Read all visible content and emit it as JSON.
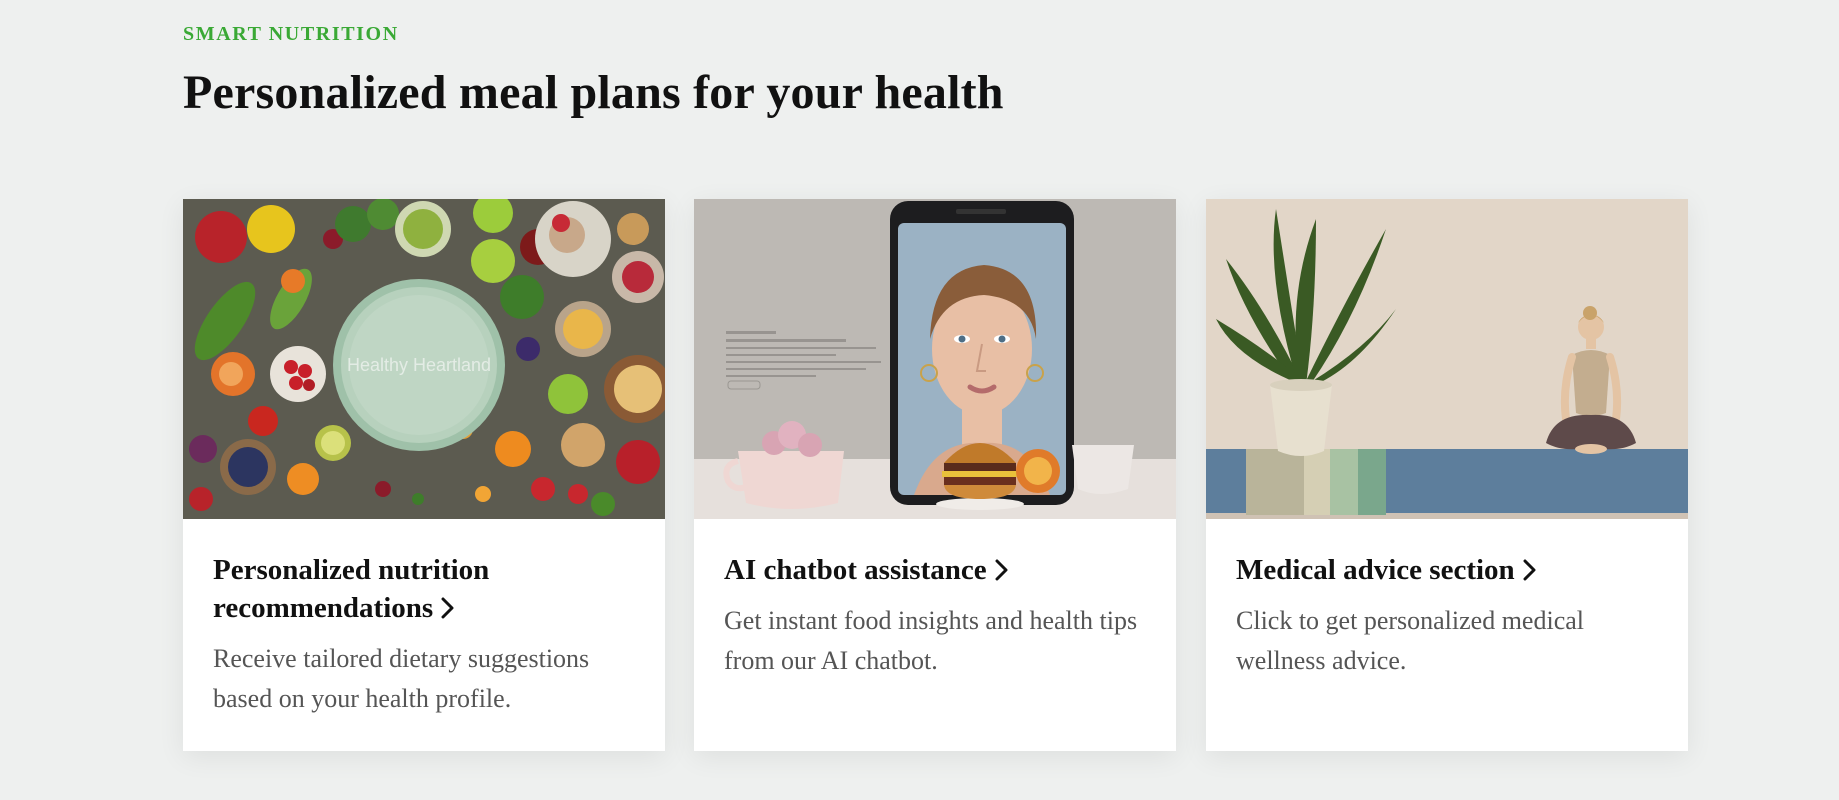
{
  "section": {
    "eyebrow": "SMART NUTRITION",
    "heading": "Personalized meal plans for your health"
  },
  "cards": [
    {
      "title": "Personalized nutrition recommendations",
      "description": "Receive tailored dietary suggestions based on your health profile.",
      "image": "Healthy Heartland",
      "arrow_icon": "chevron-right-icon"
    },
    {
      "title": "AI chatbot assistance",
      "description": "Get instant food insights and health tips from our AI chatbot.",
      "image": "smartphone-woman-burger",
      "arrow_icon": "chevron-right-icon"
    },
    {
      "title": "Medical advice section",
      "description": "Click to get personalized medical wellness advice.",
      "image": "yoga-woman-plant",
      "arrow_icon": "chevron-right-icon"
    }
  ],
  "colors": {
    "accent": "#3aa935",
    "background": "#eef0ef",
    "card": "#ffffff",
    "title": "#111111",
    "body_text": "#555555"
  }
}
